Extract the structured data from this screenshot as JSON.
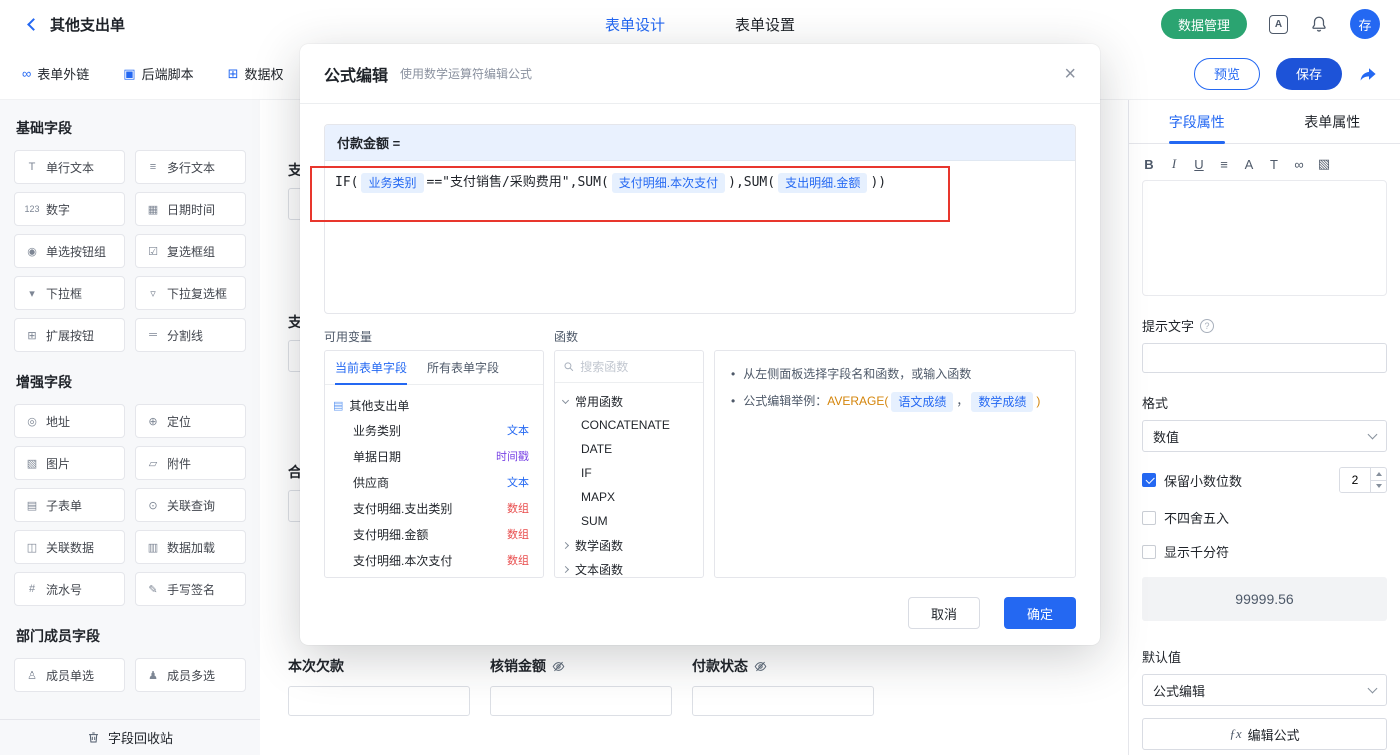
{
  "header": {
    "title": "其他支出单",
    "tabs": [
      {
        "label": "表单设计"
      },
      {
        "label": "表单设置"
      }
    ],
    "data_manage_button": "数据管理",
    "apps_icon_glyph": "A",
    "avatar_text": "存"
  },
  "toolbar": {
    "items": [
      {
        "icon": "∞",
        "label": "表单外链"
      },
      {
        "icon": "▣",
        "label": "后端脚本"
      },
      {
        "icon": "⊞",
        "label": "数据权"
      }
    ],
    "preview_button": "预览",
    "save_button": "保存"
  },
  "sidebar": {
    "sections": [
      {
        "title": "基础字段",
        "items": [
          {
            "icon": "T",
            "label": "单行文本"
          },
          {
            "icon": "≡",
            "label": "多行文本"
          },
          {
            "icon": "123",
            "label": "数字"
          },
          {
            "icon": "▦",
            "label": "日期时间"
          },
          {
            "icon": "◉",
            "label": "单选按钮组"
          },
          {
            "icon": "☑",
            "label": "复选框组"
          },
          {
            "icon": "▾",
            "label": "下拉框"
          },
          {
            "icon": "▿",
            "label": "下拉复选框"
          },
          {
            "icon": "⊞",
            "label": "扩展按钮"
          },
          {
            "icon": "═",
            "label": "分割线"
          }
        ]
      },
      {
        "title": "增强字段",
        "items": [
          {
            "icon": "◎",
            "label": "地址"
          },
          {
            "icon": "⊕",
            "label": "定位"
          },
          {
            "icon": "▧",
            "label": "图片"
          },
          {
            "icon": "▱",
            "label": "附件"
          },
          {
            "icon": "▤",
            "label": "子表单"
          },
          {
            "icon": "⊙",
            "label": "关联查询"
          },
          {
            "icon": "◫",
            "label": "关联数据"
          },
          {
            "icon": "▥",
            "label": "数据加载"
          },
          {
            "icon": "#",
            "label": "流水号"
          },
          {
            "icon": "✎",
            "label": "手写签名"
          }
        ]
      },
      {
        "title": "部门成员字段",
        "items": [
          {
            "icon": "♙",
            "label": "成员单选"
          },
          {
            "icon": "♟",
            "label": "成员多选"
          }
        ]
      }
    ],
    "recycle_bin_label": "字段回收站"
  },
  "canvas": {
    "truncated_labels": [
      "支",
      "支",
      "合"
    ],
    "bottom_fields": [
      {
        "label": "本次欠款"
      },
      {
        "label": "核销金额"
      },
      {
        "label": "付款状态"
      }
    ]
  },
  "modal": {
    "title": "公式编辑",
    "subtitle": "使用数学运算符编辑公式",
    "close_icon": "×",
    "target_label": "付款金额 =",
    "formula_parts": [
      "IF(",
      "业务类别",
      "==\"支付销售/采购费用\",SUM(",
      "支付明细.本次支付",
      "),SUM(",
      "支出明细.金额",
      "))"
    ],
    "variables": {
      "section_label": "可用变量",
      "tabs": [
        {
          "label": "当前表单字段"
        },
        {
          "label": "所有表单字段"
        }
      ],
      "root_icon": "▤",
      "root_label": "其他支出单",
      "fields": [
        {
          "name": "业务类别",
          "type": "文本"
        },
        {
          "name": "单据日期",
          "type": "时间戳"
        },
        {
          "name": "供应商",
          "type": "文本"
        },
        {
          "name": "支付明细.支出类别",
          "type": "数组"
        },
        {
          "name": "支付明细.金额",
          "type": "数组"
        },
        {
          "name": "支付明细.本次支付",
          "type": "数组"
        }
      ]
    },
    "functions": {
      "section_label": "函数",
      "search_placeholder": "搜索函数",
      "group_common": "常用函数",
      "common_items": [
        "CONCATENATE",
        "DATE",
        "IF",
        "MAPX",
        "SUM"
      ],
      "group_math": "数学函数",
      "group_text": "文本函数"
    },
    "tips": {
      "line1": "从左侧面板选择字段名和函数，或输入函数",
      "line2_prefix": "公式编辑举例：",
      "func": "AVERAGE(",
      "token1": "语文成绩",
      "separator": "，",
      "token2": "数学成绩",
      "suffix": ")"
    },
    "cancel_button": "取消",
    "confirm_button": "确定"
  },
  "props": {
    "tabs": [
      {
        "label": "字段属性"
      },
      {
        "label": "表单属性"
      }
    ],
    "editor_icons": [
      "B",
      "I",
      "U",
      "≡",
      "A",
      "T",
      "∞",
      "▧"
    ],
    "hint_label": "提示文字",
    "help_icon": "?",
    "format_label": "格式",
    "format_value": "数值",
    "decimal_label": "保留小数位数",
    "decimal_value": "2",
    "no_rounding_label": "不四舍五入",
    "thousand_label": "显示千分符",
    "preview_value": "99999.56",
    "default_label": "默认值",
    "default_value": "公式编辑",
    "formula_fx": "ƒx",
    "formula_button_label": "编辑公式"
  }
}
